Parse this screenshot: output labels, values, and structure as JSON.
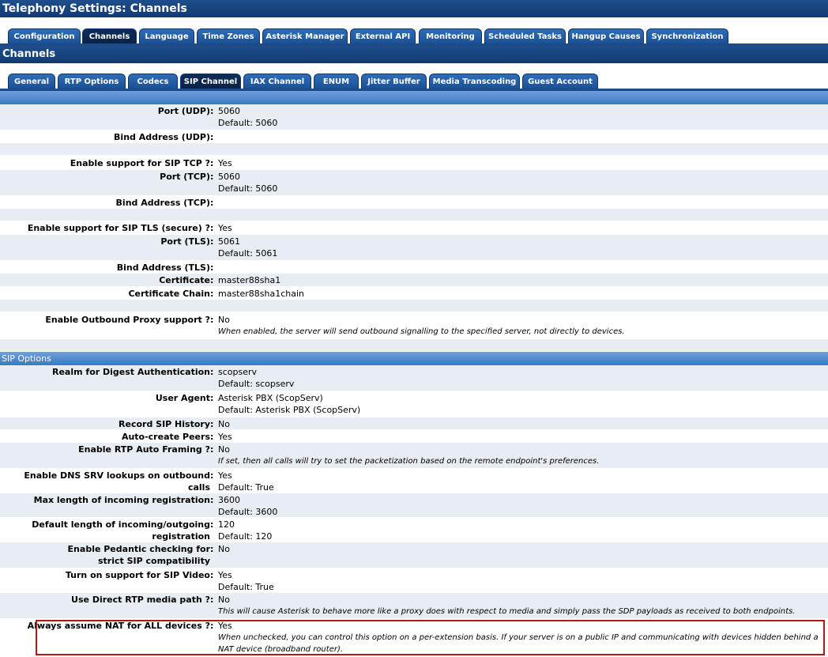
{
  "page_title": "Telephony Settings:  Channels",
  "main_tabs": [
    {
      "label": "Configuration",
      "active": false
    },
    {
      "label": "Channels",
      "active": true
    },
    {
      "label": "Language",
      "active": false
    },
    {
      "label": "Time Zones",
      "active": false
    },
    {
      "label": "Asterisk Manager",
      "active": false
    },
    {
      "label": "External API",
      "active": false
    },
    {
      "label": "Monitoring",
      "active": false
    },
    {
      "label": "Scheduled Tasks",
      "active": false
    },
    {
      "label": "Hangup Causes",
      "active": false
    },
    {
      "label": "Synchronization",
      "active": false
    }
  ],
  "section_title": "Channels",
  "sub_tabs": [
    {
      "label": "General",
      "active": false
    },
    {
      "label": "RTP Options",
      "active": false
    },
    {
      "label": "Codecs",
      "active": false
    },
    {
      "label": "SIP Channel",
      "active": true
    },
    {
      "label": "IAX Channel",
      "active": false
    },
    {
      "label": "ENUM",
      "active": false
    },
    {
      "label": "Jitter Buffer",
      "active": false
    },
    {
      "label": "Media Transcoding",
      "active": false
    },
    {
      "label": "Guest Account",
      "active": false
    }
  ],
  "general_rows": [
    {
      "label": "Port (UDP)",
      "value": "5060",
      "default": "Default: 5060",
      "note": ""
    },
    {
      "label": "Bind Address (UDP)",
      "value": "",
      "default": "",
      "note": ""
    },
    {
      "label": "",
      "value": "",
      "default": "",
      "note": ""
    },
    {
      "label": "Enable support for SIP TCP ?",
      "value": "Yes",
      "default": "",
      "note": ""
    },
    {
      "label": "Port (TCP)",
      "value": "5060",
      "default": "Default: 5060",
      "note": ""
    },
    {
      "label": "Bind Address (TCP)",
      "value": "",
      "default": "",
      "note": ""
    },
    {
      "label": "",
      "value": "",
      "default": "",
      "note": ""
    },
    {
      "label": "Enable support for SIP TLS (secure) ?",
      "value": "Yes",
      "default": "",
      "note": ""
    },
    {
      "label": "Port (TLS)",
      "value": "5061",
      "default": "Default: 5061",
      "note": ""
    },
    {
      "label": "Bind Address (TLS)",
      "value": "",
      "default": "",
      "note": ""
    },
    {
      "label": "Certificate",
      "value": "master88sha1",
      "default": "",
      "note": ""
    },
    {
      "label": "Certificate Chain",
      "value": "master88sha1chain",
      "default": "",
      "note": ""
    },
    {
      "label": "",
      "value": "",
      "default": "",
      "note": ""
    },
    {
      "label": "Enable Outbound Proxy support ?",
      "value": "No",
      "default": "",
      "note": "When enabled, the server will send outbound signalling to the specified server, not directly to devices."
    },
    {
      "label": "",
      "value": "",
      "default": "",
      "note": ""
    }
  ],
  "sip_options_title": "SIP Options",
  "sip_rows": [
    {
      "label": "Realm for Digest Authentication",
      "value": "scopserv",
      "default": "Default: scopserv",
      "note": ""
    },
    {
      "label": "User Agent",
      "value": "Asterisk PBX (ScopServ)",
      "default": "Default: Asterisk PBX (ScopServ)",
      "note": ""
    },
    {
      "label": "Record SIP History",
      "value": "No",
      "default": "",
      "note": ""
    },
    {
      "label": "Auto-create Peers",
      "value": "Yes",
      "default": "",
      "note": ""
    },
    {
      "label": "Enable RTP Auto Framing ?",
      "value": "No",
      "default": "",
      "note": "If set, then all calls will try to set the packetization based on the remote endpoint's preferences."
    },
    {
      "label": "Enable DNS SRV lookups on outbound calls",
      "value": "Yes",
      "default": "Default: True",
      "note": ""
    },
    {
      "label": "Max length of incoming registration",
      "value": "3600",
      "default": "Default: 3600",
      "note": ""
    },
    {
      "label": "Default length of incoming/outgoing registration",
      "value": "120",
      "default": "Default: 120",
      "note": ""
    },
    {
      "label": "Enable Pedantic checking for strict SIP compatibility",
      "value": "No",
      "default": "",
      "note": ""
    },
    {
      "label": "Turn on support for SIP Video",
      "value": "Yes",
      "default": "Default: True",
      "note": ""
    },
    {
      "label": "Use Direct RTP media path ?",
      "value": "No",
      "default": "",
      "note": "This will cause Asterisk to behave more like a proxy does with respect to media and simply pass the SDP payloads as received to both endpoints."
    },
    {
      "label": "Always assume NAT for ALL devices ?",
      "value": "Yes",
      "default": "",
      "note": "When unchecked, you can control this option on a per-extension basis. If your server is on a public IP and communicating with devices hidden behind a NAT device (broadband router)."
    }
  ],
  "colors": {
    "header_blue": "#1f4e8c",
    "bar_blue": "#3b77c2",
    "row_alt": "#e8edf3",
    "highlight_red": "#b01818"
  }
}
